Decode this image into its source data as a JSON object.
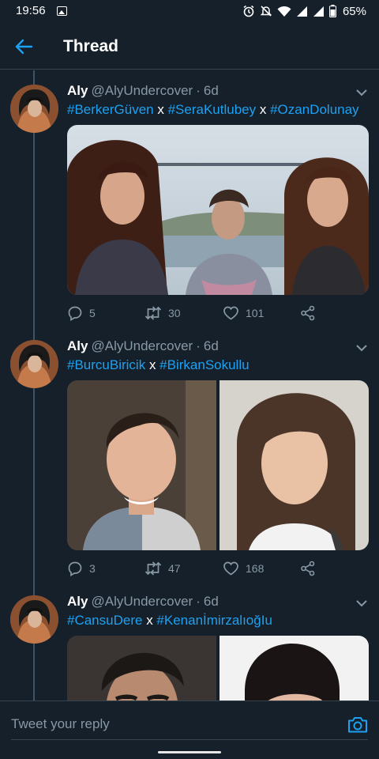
{
  "status_bar": {
    "time": "19:56",
    "battery": "65%"
  },
  "header": {
    "title": "Thread"
  },
  "tweets": [
    {
      "name": "Aly",
      "handle": "@AlyUndercover",
      "dot": "·",
      "time": "6d",
      "hashtags": [
        "#BerkerGüven",
        "#SeraKutlubey",
        "#OzanDolunay"
      ],
      "separator": "x",
      "replies": "5",
      "retweets": "30",
      "likes": "101"
    },
    {
      "name": "Aly",
      "handle": "@AlyUndercover",
      "dot": "·",
      "time": "6d",
      "hashtags": [
        "#BurcuBiricik",
        "#BirkanSokullu"
      ],
      "separator": "x",
      "replies": "3",
      "retweets": "47",
      "likes": "168"
    },
    {
      "name": "Aly",
      "handle": "@AlyUndercover",
      "dot": "·",
      "time": "6d",
      "hashtags": [
        "#CansuDere",
        "#KenanİmirzalıoğIu"
      ],
      "separator": "x"
    }
  ],
  "reply": {
    "placeholder": "Tweet your reply"
  },
  "colors": {
    "background": "#15202b",
    "accent": "#1da1f2",
    "secondary_text": "#8899a6",
    "divider": "#38444d"
  }
}
